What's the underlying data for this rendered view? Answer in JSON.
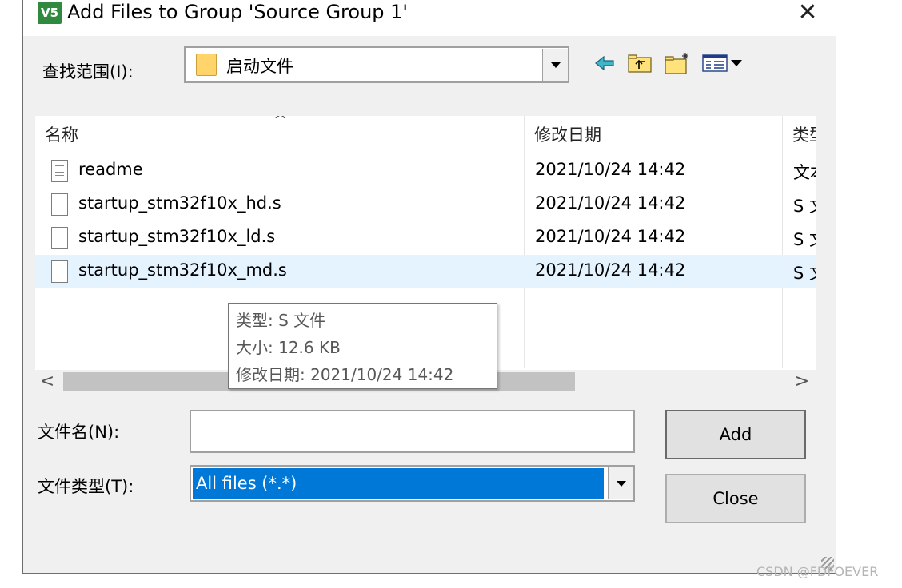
{
  "window": {
    "title": "Add Files to Group 'Source Group 1'",
    "close_glyph": "✕",
    "icon_text": "V5"
  },
  "look_in": {
    "label": "查找范围(I):",
    "value": "启动文件",
    "icon": "folder-icon"
  },
  "toolbar": {
    "back_icon": "back-arrow-icon",
    "up_icon": "up-folder-icon",
    "new_folder_icon": "new-folder-icon",
    "view_icon": "view-menu-icon"
  },
  "file_list": {
    "columns": {
      "name": "名称",
      "date": "修改日期",
      "type": "类型"
    },
    "sort_indicator": "^",
    "rows": [
      {
        "name": "readme",
        "date": "2021/10/24 14:42",
        "type": "文本"
      },
      {
        "name": "startup_stm32f10x_hd.s",
        "date": "2021/10/24 14:42",
        "type": "S 文件"
      },
      {
        "name": "startup_stm32f10x_ld.s",
        "date": "2021/10/24 14:42",
        "type": "S 文件"
      },
      {
        "name": "startup_stm32f10x_md.s",
        "date": "2021/10/24 14:42",
        "type": "S 文件"
      }
    ],
    "scroll_left": "<",
    "scroll_right": ">"
  },
  "tooltip": {
    "type_line": "类型: S 文件",
    "size_line": "大小: 12.6 KB",
    "date_line": "修改日期: 2021/10/24 14:42"
  },
  "file_name": {
    "label": "文件名(N):",
    "value": ""
  },
  "file_type": {
    "label": "文件类型(T):",
    "value": "All files (*.*)"
  },
  "buttons": {
    "add": "Add",
    "close": "Close"
  },
  "watermark": "CSDN @FDFOEVER",
  "colors": {
    "selection": "#0078d7",
    "hover_row": "#e5f3ff",
    "folder": "#ffd56b"
  }
}
